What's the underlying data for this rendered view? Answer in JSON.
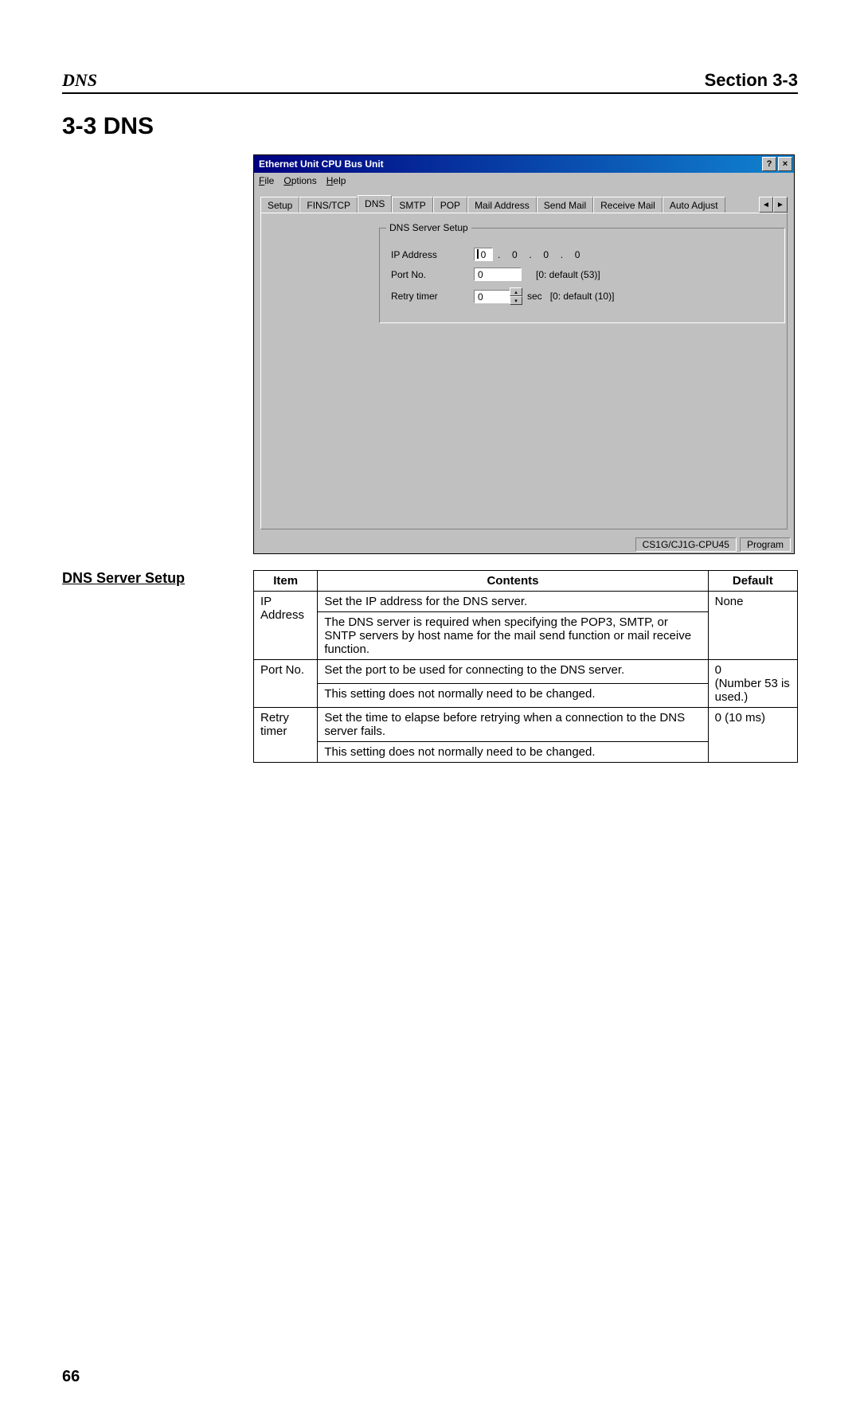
{
  "header": {
    "left": "DNS",
    "right": "Section 3-3"
  },
  "heading": "3-3  DNS",
  "subheading": "DNS Server Setup",
  "dialog": {
    "title": "Ethernet Unit CPU Bus Unit",
    "help_glyph": "?",
    "close_glyph": "×",
    "menu": {
      "file": "File",
      "options": "Options",
      "help": "Help"
    },
    "tabs": {
      "setup": "Setup",
      "fins_tcp": "FINS/TCP",
      "dns": "DNS",
      "smtp": "SMTP",
      "pop": "POP",
      "mail_address": "Mail Address",
      "send_mail": "Send Mail",
      "receive_mail": "Receive Mail",
      "auto_adjust": "Auto Adjust"
    },
    "scroll_left": "◄",
    "scroll_right": "►",
    "group_legend": "DNS Server Setup",
    "labels": {
      "ip": "IP Address",
      "port": "Port No.",
      "retry": "Retry timer"
    },
    "ip_octets": [
      "0",
      "0",
      "0",
      "0"
    ],
    "port_value": "0",
    "port_hint": "[0: default (53)]",
    "retry_value": "0",
    "retry_unit": "sec",
    "retry_hint": "[0: default (10)]",
    "spin_up": "▴",
    "spin_down": "▾",
    "status": {
      "cpu": "CS1G/CJ1G-CPU45",
      "mode": "Program"
    }
  },
  "table": {
    "headers": {
      "item": "Item",
      "contents": "Contents",
      "default": "Default"
    },
    "rows": [
      {
        "item": "IP Address",
        "contents_1": "Set the IP address for the DNS server.",
        "contents_2": "The DNS server is required when specifying the POP3, SMTP, or SNTP servers by host name for the mail send function or mail receive function.",
        "default": "None"
      },
      {
        "item": "Port No.",
        "contents_1": "Set the port to be used for connecting to the DNS server.",
        "contents_2": "This setting does not normally need to be changed.",
        "default": "0\n(Number 53 is used.)"
      },
      {
        "item": "Retry timer",
        "contents_1": "Set the time to elapse before retrying when a connection to the DNS server fails.",
        "contents_2": "This setting does not normally need to be changed.",
        "default": "0 (10 ms)"
      }
    ]
  },
  "page_number": "66"
}
